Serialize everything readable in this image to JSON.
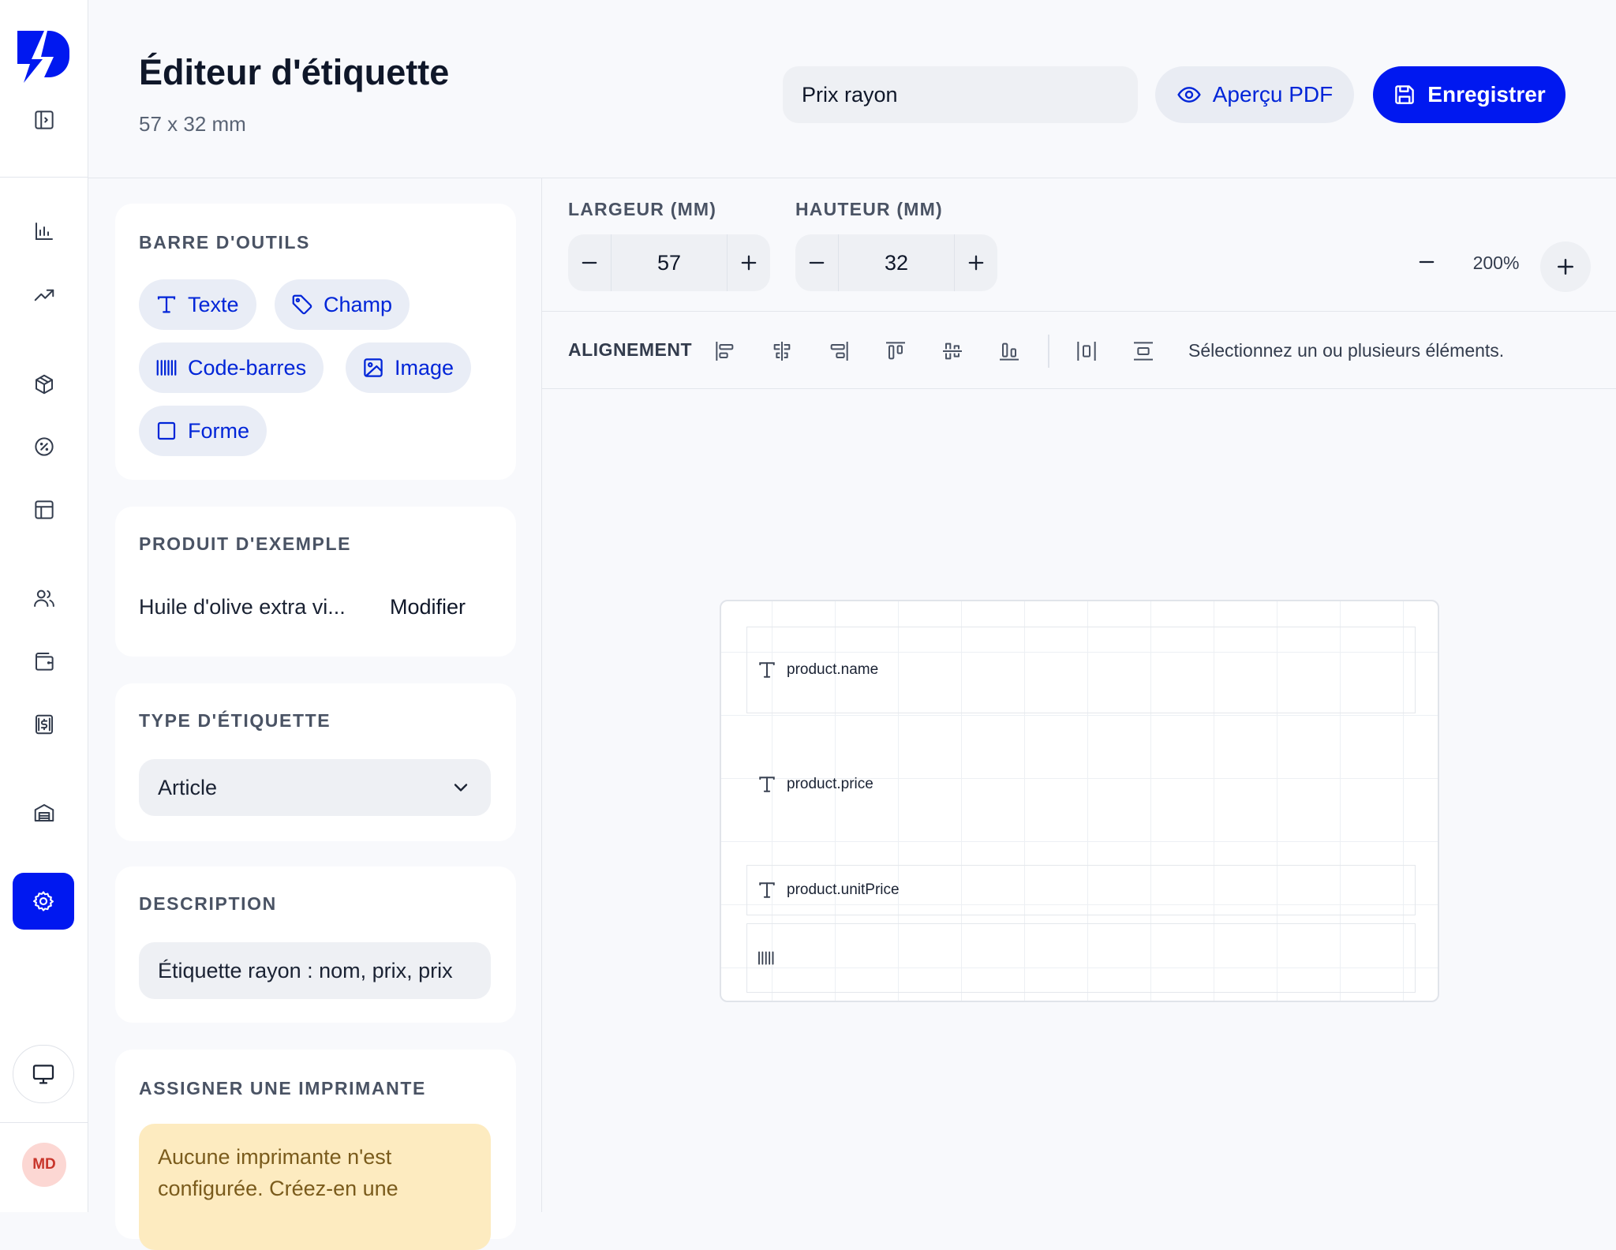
{
  "header": {
    "title": "Éditeur d'étiquette",
    "subtitle": "57 x 32 mm",
    "label_name_value": "Prix rayon",
    "preview_label": "Aperçu PDF",
    "save_label": "Enregistrer"
  },
  "nav": {
    "avatar_initials": "MD",
    "active_item": "settings",
    "items": [
      "sidebar-toggle",
      "reports",
      "trends",
      "products",
      "promotions",
      "tables",
      "customers",
      "wallet",
      "pricing",
      "warehouse",
      "settings",
      "display"
    ]
  },
  "toolbar_card": {
    "title": "BARRE D'OUTILS",
    "tools": [
      "Texte",
      "Champ",
      "Code-barres",
      "Image",
      "Forme"
    ]
  },
  "sample_product": {
    "title": "PRODUIT D'EXEMPLE",
    "name": "Huile d'olive extra vi...",
    "edit_label": "Modifier"
  },
  "label_type": {
    "title": "TYPE D'ÉTIQUETTE",
    "value": "Article"
  },
  "description": {
    "title": "DESCRIPTION",
    "value": "Étiquette rayon : nom, prix, prix"
  },
  "printer": {
    "title": "ASSIGNER UNE IMPRIMANTE",
    "warning": "Aucune imprimante n'est configurée. Créez-en une"
  },
  "dimensions": {
    "width_label": "LARGEUR (MM)",
    "width_value": "57",
    "height_label": "HAUTEUR (MM)",
    "height_value": "32"
  },
  "zoom": {
    "value": "200%"
  },
  "alignment": {
    "label": "ALIGNEMENT",
    "hint": "Sélectionnez un ou plusieurs éléments."
  },
  "canvas": {
    "elements": [
      {
        "type": "text",
        "field": "product.name"
      },
      {
        "type": "text",
        "field": "product.price"
      },
      {
        "type": "text",
        "field": "product.unitPrice"
      },
      {
        "type": "barcode",
        "field": ""
      }
    ]
  },
  "colors": {
    "accent": "#0018f0",
    "accent_text": "#0025d8",
    "warning_bg": "#fdebc0",
    "warning_text": "#7a5b1c",
    "avatar_bg": "#fcd7d3",
    "avatar_text": "#c8352b"
  }
}
